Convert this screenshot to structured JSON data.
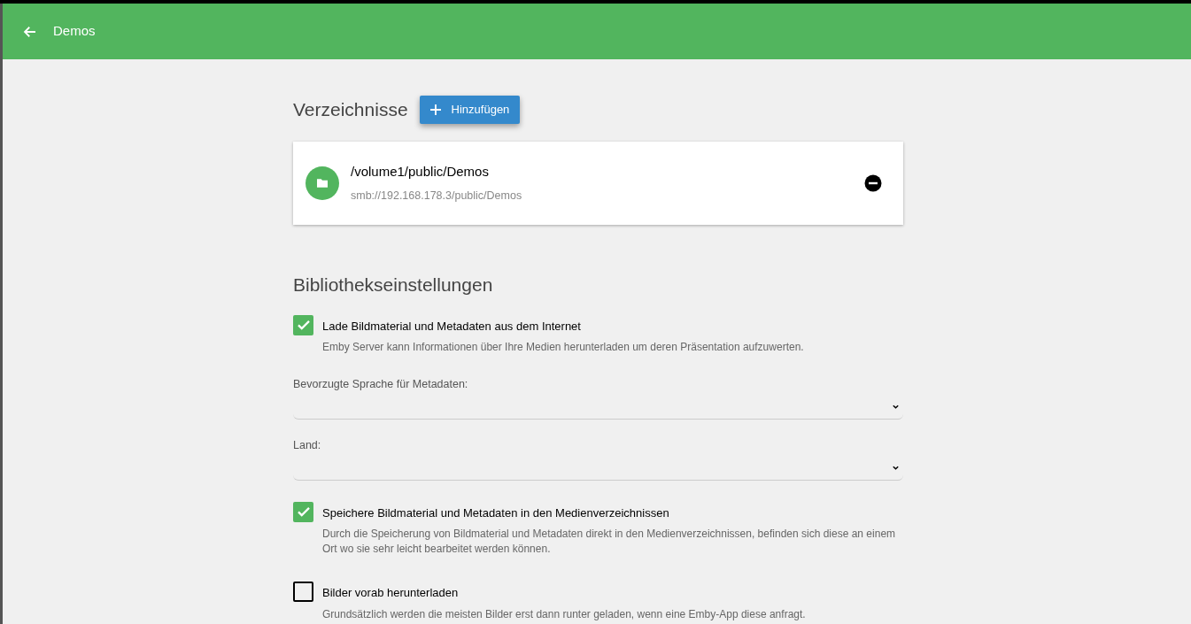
{
  "header": {
    "title": "Demos"
  },
  "folders": {
    "title": "Verzeichnisse",
    "add_button": "Hinzufügen",
    "items": [
      {
        "path": "/volume1/public/Demos",
        "network_path": "smb://192.168.178.3/public/Demos"
      }
    ]
  },
  "library_settings": {
    "title": "Bibliothekseinstellungen",
    "items": [
      {
        "kind": "checkbox",
        "label": "Lade Bildmaterial und Metadaten aus dem Internet",
        "description": "Emby Server kann Informationen über Ihre Medien herunterladen um deren Präsentation aufzuwerten.",
        "checked": true
      },
      {
        "kind": "select",
        "label": "Bevorzugte Sprache für Metadaten:"
      },
      {
        "kind": "select",
        "label": "Land:"
      },
      {
        "kind": "checkbox",
        "label": "Speichere Bildmaterial und Metadaten in den Medienverzeichnissen",
        "description": "Durch die Speicherung von Bildmaterial und Metadaten direkt in den Medienverzeichnissen, befinden sich diese an einem Ort wo sie sehr leicht bearbeitet werden können.",
        "checked": true
      },
      {
        "kind": "checkbox",
        "label": "Bilder vorab herunterladen",
        "description": "Grundsätzlich werden die meisten Bilder erst dann runter geladen, wenn eine Emby-App diese anfragt.",
        "checked": false
      }
    ]
  }
}
